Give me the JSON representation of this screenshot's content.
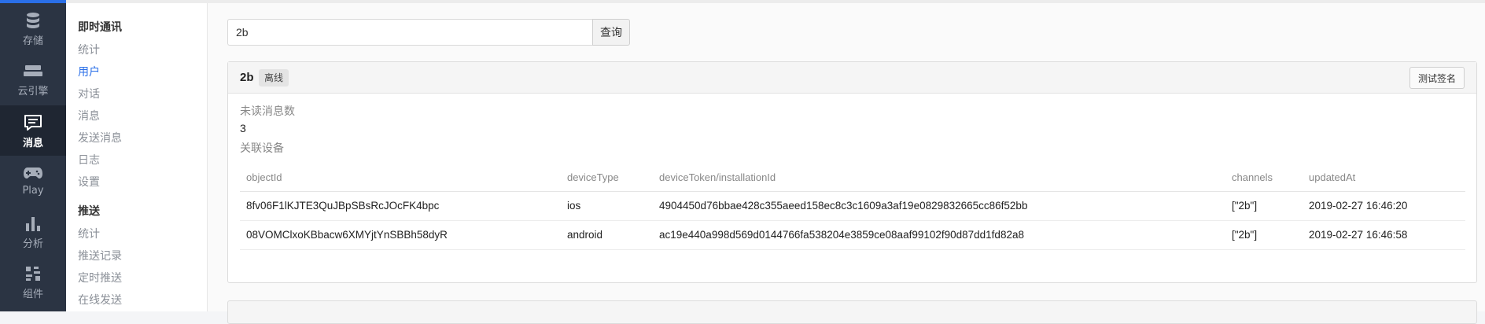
{
  "rail": {
    "items": [
      {
        "label": "存储",
        "icon": "database-icon"
      },
      {
        "label": "云引擎",
        "icon": "server-icon"
      },
      {
        "label": "消息",
        "icon": "message-icon",
        "active": true
      },
      {
        "label": "Play",
        "icon": "gamepad-icon"
      },
      {
        "label": "分析",
        "icon": "bar-chart-icon"
      },
      {
        "label": "组件",
        "icon": "components-icon"
      }
    ]
  },
  "subnav": {
    "im_group": "即时通讯",
    "im_items": [
      "统计",
      "用户",
      "对话",
      "消息",
      "发送消息",
      "日志",
      "设置"
    ],
    "push_group": "推送",
    "push_items": [
      "统计",
      "推送记录",
      "定时推送",
      "在线发送"
    ]
  },
  "search": {
    "value": "2b",
    "button_label": "查询"
  },
  "user_panel": {
    "user_id": "2b",
    "status_badge": "离线",
    "test_signature_button": "测试签名",
    "unread_label": "未读消息数",
    "unread_count": "3",
    "devices_label": "关联设备",
    "columns": [
      "objectId",
      "deviceType",
      "deviceToken/installationId",
      "channels",
      "updatedAt"
    ],
    "rows": [
      [
        "8fv06F1lKJTE3QuJBpSBsRcJOcFK4bpc",
        "ios",
        "4904450d76bbae428c355aeed158ec8c3c1609a3af19e0829832665cc86f52bb",
        "[\"2b\"]",
        "2019-02-27 16:46:20"
      ],
      [
        "08VOMClxoKBbacw6XMYjtYnSBBh58dyR",
        "android",
        "ac19e440a998d569d0144766fa538204e3859ce08aaf99102f90d87dd1fd82a8",
        "[\"2b\"]",
        "2019-02-27 16:46:58"
      ]
    ]
  },
  "colors": {
    "accent": "#2a6fe8",
    "rail_bg": "#2b3443",
    "rail_active_bg": "#1f2632"
  }
}
